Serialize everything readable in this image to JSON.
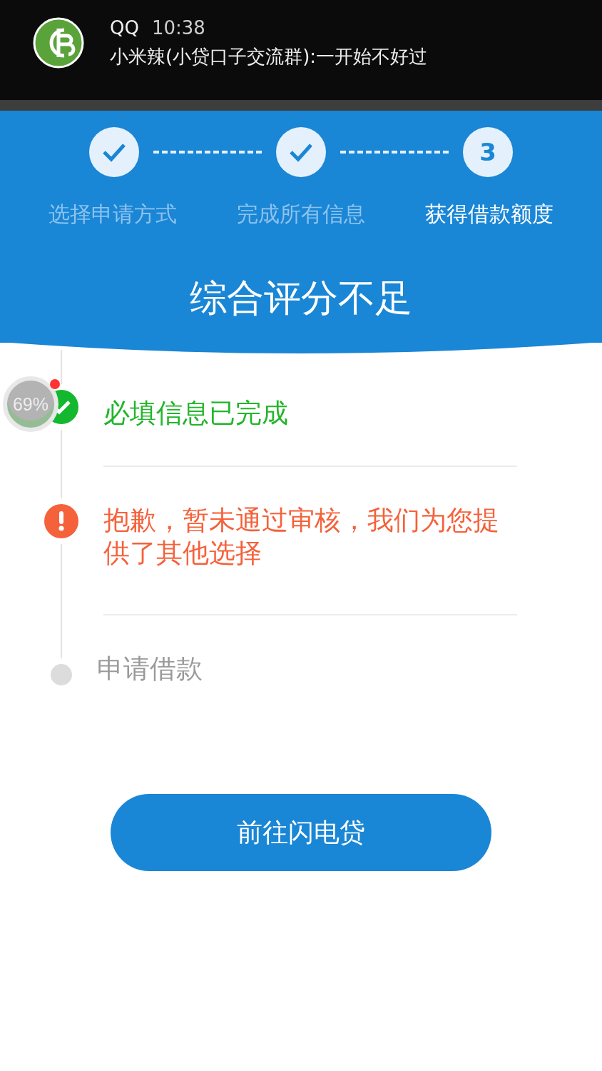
{
  "notification": {
    "app": "QQ",
    "time": "10:38",
    "message": "小米辣(小贷口子交流群):一开始不好过"
  },
  "steps": [
    {
      "label": "选择申请方式",
      "completed": true
    },
    {
      "label": "完成所有信息",
      "completed": true
    },
    {
      "label": "获得借款额度",
      "completed": false,
      "number": "3"
    }
  ],
  "headline": "综合评分不足",
  "timeline": [
    {
      "kind": "success",
      "text": "必填信息已完成"
    },
    {
      "kind": "error",
      "text": "抱歉，暂未通过审核，我们为您提供了其他选择"
    },
    {
      "kind": "pending",
      "text": "申请借款"
    }
  ],
  "floating_ball": {
    "text": "69%"
  },
  "button": {
    "label": "前往闪电贷"
  }
}
